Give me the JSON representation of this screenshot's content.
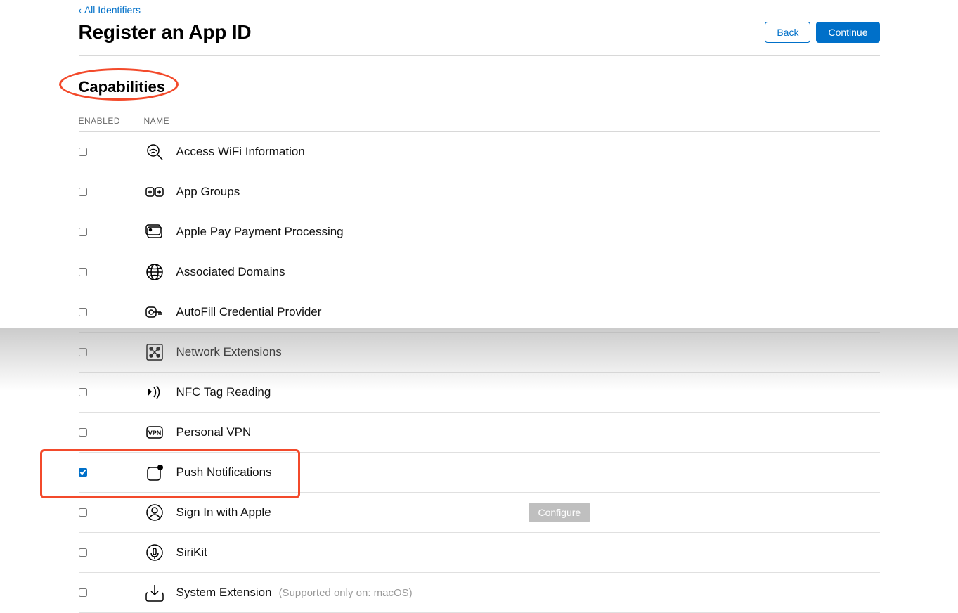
{
  "nav": {
    "back_label": "All Identifiers"
  },
  "header": {
    "title": "Register an App ID",
    "back_button": "Back",
    "continue_button": "Continue"
  },
  "section": {
    "title": "Capabilities"
  },
  "table": {
    "col_enabled": "ENABLED",
    "col_name": "NAME"
  },
  "actions": {
    "configure": "Configure"
  },
  "capabilities": [
    {
      "id": "access-wifi",
      "name": "Access WiFi Information",
      "checked": false,
      "icon": "wifi-search"
    },
    {
      "id": "app-groups",
      "name": "App Groups",
      "checked": false,
      "icon": "groups"
    },
    {
      "id": "apple-pay",
      "name": "Apple Pay Payment Processing",
      "checked": false,
      "icon": "wallet"
    },
    {
      "id": "associated-domains",
      "name": "Associated Domains",
      "checked": false,
      "icon": "globe"
    },
    {
      "id": "autofill",
      "name": "AutoFill Credential Provider",
      "checked": false,
      "icon": "key"
    },
    {
      "id": "network-ext",
      "name": "Network Extensions",
      "checked": false,
      "icon": "network"
    },
    {
      "id": "nfc",
      "name": "NFC Tag Reading",
      "checked": false,
      "icon": "nfc"
    },
    {
      "id": "personal-vpn",
      "name": "Personal VPN",
      "checked": false,
      "icon": "vpn"
    },
    {
      "id": "push",
      "name": "Push Notifications",
      "checked": true,
      "icon": "push",
      "highlight": true
    },
    {
      "id": "sign-in-apple",
      "name": "Sign In with Apple",
      "checked": false,
      "icon": "person",
      "configure": true
    },
    {
      "id": "sirikit",
      "name": "SiriKit",
      "checked": false,
      "icon": "mic"
    },
    {
      "id": "system-ext",
      "name": "System Extension",
      "checked": false,
      "icon": "download",
      "note": "(Supported only on: macOS)"
    }
  ]
}
